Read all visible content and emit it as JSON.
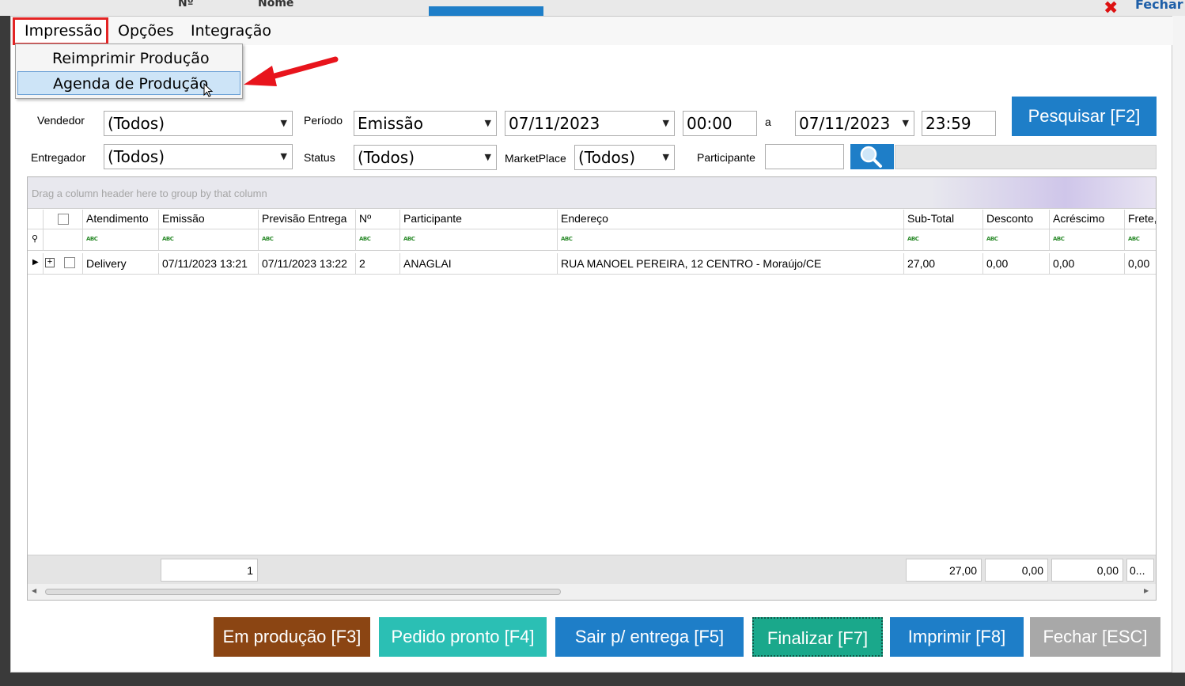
{
  "background": {
    "header_no": "Nº",
    "header_nome": "Nome",
    "fechar_label": "Fechar"
  },
  "menu": {
    "items": [
      "Impressão",
      "Opções",
      "Integração"
    ],
    "dropdown": [
      "Reimprimir Produção",
      "Agenda de Produção"
    ]
  },
  "filters": {
    "vendedor_label": "Vendedor",
    "vendedor_value": "(Todos)",
    "periodo_label": "Período",
    "periodo_value": "Emissão",
    "date_from": "07/11/2023",
    "time_from": "00:00",
    "ate_label": "a",
    "date_to": "07/11/2023",
    "time_to": "23:59",
    "entregador_label": "Entregador",
    "entregador_value": "(Todos)",
    "status_label": "Status",
    "status_value": "(Todos)",
    "marketplace_label": "MarketPlace",
    "marketplace_value": "(Todos)",
    "participante_label": "Participante",
    "participante_value": "",
    "pesquisar_label": "Pesquisar [F2]"
  },
  "grid": {
    "group_hint": "Drag a column header here to group by that column",
    "columns": [
      "Atendimento",
      "Emissão",
      "Previsão Entrega",
      "Nº",
      "Participante",
      "Endereço",
      "Sub-Total",
      "Desconto",
      "Acréscimo",
      "Frete,"
    ],
    "rows": [
      [
        "Delivery",
        "07/11/2023 13:21",
        "07/11/2023 13:22",
        "2",
        "ANAGLAI",
        "RUA MANOEL PEREIRA, 12  CENTRO - Moraújo/CE",
        "27,00",
        "0,00",
        "0,00",
        "0,00"
      ]
    ],
    "totals": {
      "count": "1",
      "subtotal": "27,00",
      "desconto": "0,00",
      "acrescimo": "0,00",
      "frete": "0..."
    }
  },
  "buttons": {
    "em_producao": "Em produção [F3]",
    "pedido_pronto": "Pedido pronto [F4]",
    "sair_entrega": "Sair p/ entrega [F5]",
    "finalizar": "Finalizar [F7]",
    "imprimir": "Imprimir [F8]",
    "fechar": "Fechar [ESC]"
  },
  "colors": {
    "menu_highlight_border": "#e32424",
    "annotation_arrow": "#e8141c",
    "pesquisar": "#1e7ec8",
    "em_producao": "#8b4513",
    "pedido_pronto": "#2bbfb4",
    "sair_entrega": "#1e7ec8",
    "finalizar": "#1aa88b",
    "imprimir": "#1e7ec8",
    "fechar": "#a8a8a8"
  }
}
